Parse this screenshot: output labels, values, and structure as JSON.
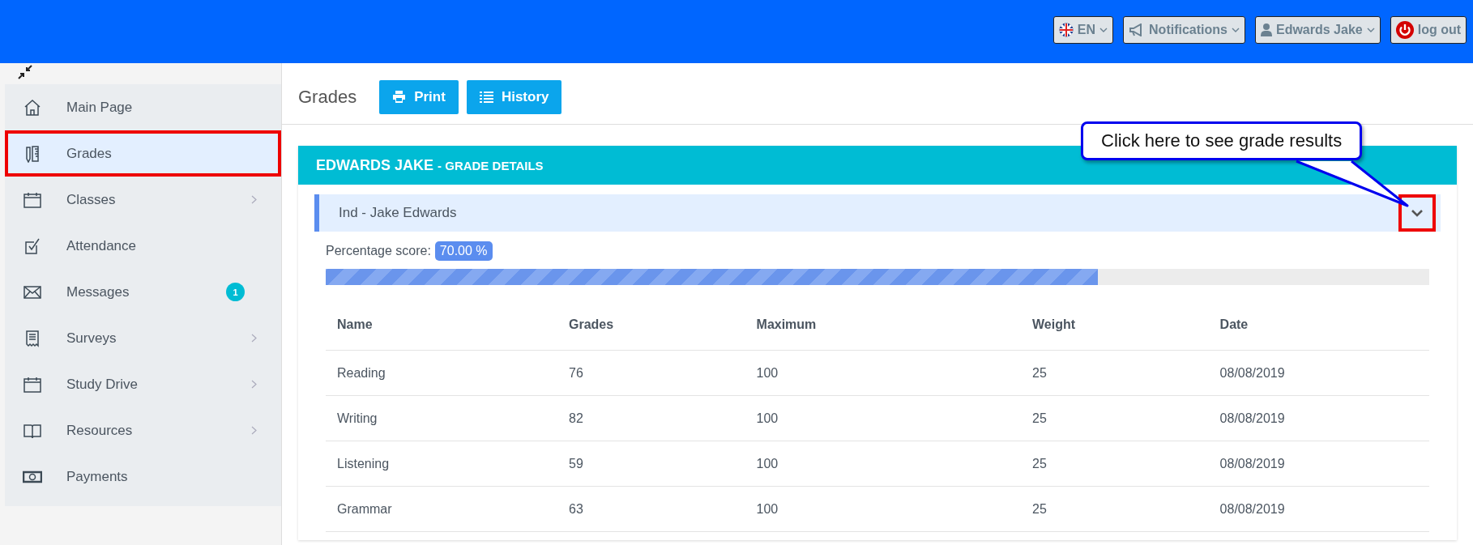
{
  "top_bar": {
    "buttons": [
      {
        "kind": "language",
        "label": "EN",
        "dropdown": true
      },
      {
        "kind": "notifications",
        "label": "Notifications",
        "dropdown": true
      },
      {
        "kind": "user",
        "label": "Edwards Jake",
        "dropdown": true
      },
      {
        "kind": "logout",
        "label": "log out",
        "dropdown": false
      }
    ]
  },
  "sidebar": {
    "items": [
      {
        "kind": "home",
        "label": "Main Page",
        "selected": false,
        "highlighted": false,
        "submenu": false
      },
      {
        "kind": "ruler",
        "label": "Grades",
        "selected": true,
        "highlighted": true,
        "submenu": false
      },
      {
        "kind": "calendar",
        "label": "Classes",
        "selected": false,
        "highlighted": false,
        "submenu": true
      },
      {
        "kind": "check",
        "label": "Attendance",
        "selected": false,
        "highlighted": false,
        "submenu": false
      },
      {
        "kind": "mail",
        "label": "Messages",
        "selected": false,
        "highlighted": false,
        "submenu": false,
        "badge": "1"
      },
      {
        "kind": "receipt",
        "label": "Surveys",
        "selected": false,
        "highlighted": false,
        "submenu": true
      },
      {
        "kind": "calendar",
        "label": "Study Drive",
        "selected": false,
        "highlighted": false,
        "submenu": true
      },
      {
        "kind": "book",
        "label": "Resources",
        "selected": false,
        "highlighted": false,
        "submenu": true
      },
      {
        "kind": "money",
        "label": "Payments",
        "selected": false,
        "highlighted": false,
        "submenu": false
      }
    ]
  },
  "page": {
    "title": "Grades",
    "buttons": [
      {
        "kind": "print",
        "label": "Print"
      },
      {
        "kind": "list",
        "label": "History"
      }
    ]
  },
  "panel": {
    "title_strong": "EDWARDS JAKE",
    "title_rest": "- GRADE DETAILS",
    "group": {
      "title": "Ind - Jake Edwards",
      "expanded": true,
      "toggle_highlighted": true
    },
    "percentage_label": "Percentage score:",
    "percentage_value": "70.00 %",
    "level": 0.7,
    "table": {
      "columns": [
        "Name",
        "Grades",
        "Maximum",
        "Weight",
        "Date"
      ],
      "rows": [
        [
          "Reading",
          "76",
          "100",
          "25",
          "08/08/2019"
        ],
        [
          "Writing",
          "82",
          "100",
          "25",
          "08/08/2019"
        ],
        [
          "Listening",
          "59",
          "100",
          "25",
          "08/08/2019"
        ],
        [
          "Grammar",
          "63",
          "100",
          "25",
          "08/08/2019"
        ]
      ]
    }
  },
  "callout": {
    "text": "Click here to see grade results"
  }
}
